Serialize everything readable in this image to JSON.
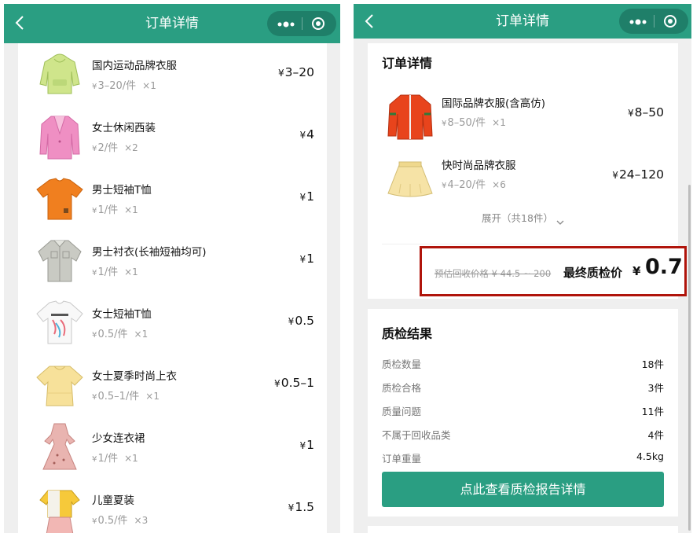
{
  "left": {
    "nav": {
      "title": "订单详情",
      "back_icon": "chevron-left-icon",
      "more_icon": "more-dots-icon",
      "close_icon": "target-icon"
    },
    "items": [
      {
        "name": "国内运动品牌衣服",
        "yen": "¥",
        "unit_price": "3–20",
        "unit_suffix": "/件",
        "qty": "×1",
        "total": "3–20",
        "icon": "green-hoodie"
      },
      {
        "name": "女士休闲西装",
        "yen": "¥",
        "unit_price": "2",
        "unit_suffix": "/件",
        "qty": "×2",
        "total": "4",
        "icon": "pink-blazer"
      },
      {
        "name": "男士短袖T恤",
        "yen": "¥",
        "unit_price": "1",
        "unit_suffix": "/件",
        "qty": "×1",
        "total": "1",
        "icon": "orange-tshirt"
      },
      {
        "name": "男士衬衣(长袖短袖均可)",
        "yen": "¥",
        "unit_price": "1",
        "unit_suffix": "/件",
        "qty": "×1",
        "total": "1",
        "icon": "gray-shirt"
      },
      {
        "name": "女士短袖T恤",
        "yen": "¥",
        "unit_price": "0.5",
        "unit_suffix": "/件",
        "qty": "×1",
        "total": "0.5",
        "icon": "white-tshirt"
      },
      {
        "name": "女士夏季时尚上衣",
        "yen": "¥",
        "unit_price": "0.5–1",
        "unit_suffix": "/件",
        "qty": "×1",
        "total": "0.5–1",
        "icon": "yellow-blouse"
      },
      {
        "name": "少女连衣裙",
        "yen": "¥",
        "unit_price": "1",
        "unit_suffix": "/件",
        "qty": "×1",
        "total": "1",
        "icon": "floral-dress"
      },
      {
        "name": "儿童夏装",
        "yen": "¥",
        "unit_price": "0.5",
        "unit_suffix": "/件",
        "qty": "×3",
        "total": "1.5",
        "icon": "kids-summer-set"
      }
    ]
  },
  "right": {
    "nav": {
      "title": "订单详情",
      "back_icon": "chevron-left-icon",
      "more_icon": "more-dots-icon",
      "close_icon": "target-icon"
    },
    "order_section_title": "订单详情",
    "items": [
      {
        "name": "国际品牌衣服(含高仿)",
        "yen": "¥",
        "unit_price": "8–50",
        "unit_suffix": "/件",
        "qty": "×1",
        "total": "8–50",
        "icon": "red-track-jacket"
      },
      {
        "name": "快时尚品牌衣服",
        "yen": "¥",
        "unit_price": "4–20",
        "unit_suffix": "/件",
        "qty": "×6",
        "total": "24–120",
        "icon": "yellow-skirt"
      }
    ],
    "expand_label": "展开（共18件）",
    "estimate_text": "预估回收价格 ¥ 44.5 ~ 200",
    "final_label": "最终质检价",
    "final_yen": "¥",
    "final_value": "0.7",
    "inspection": {
      "title": "质检结果",
      "rows": [
        {
          "label": "质检数量",
          "value": "18件"
        },
        {
          "label": "质检合格",
          "value": "3件"
        },
        {
          "label": "质量问题",
          "value": "11件"
        },
        {
          "label": "不属于回收品类",
          "value": "4件"
        },
        {
          "label": "订单重量",
          "value": "4.5kg"
        }
      ],
      "button_label": "点此查看质检报告详情"
    }
  },
  "colors": {
    "brand_green": "#2a9e82",
    "highlight_red": "#b0140b"
  }
}
